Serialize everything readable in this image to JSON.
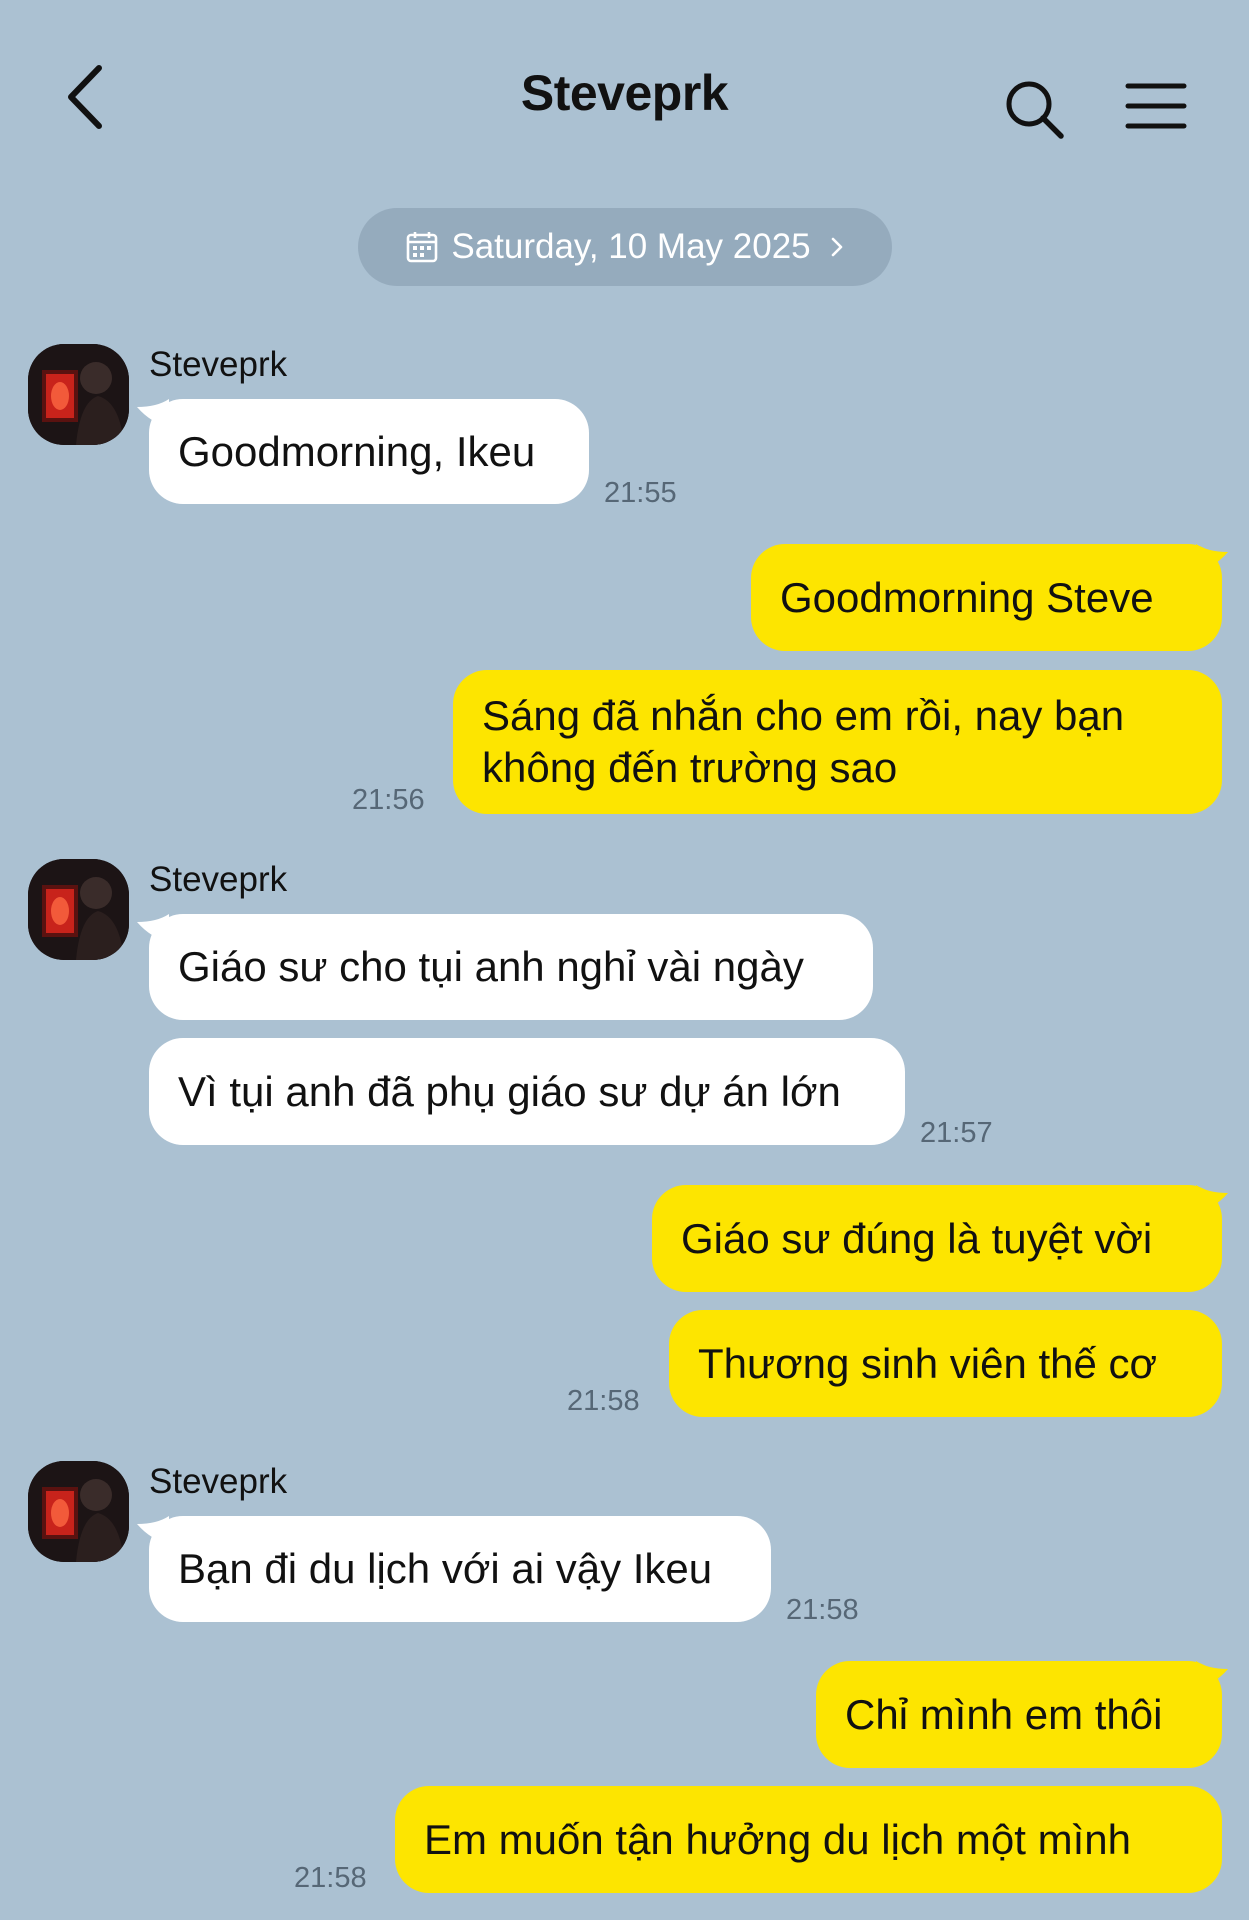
{
  "header": {
    "title": "Steveprk"
  },
  "date_label": "Saturday, 10 May 2025",
  "incoming": [
    {
      "sender": "Steveprk",
      "messages": [
        "Goodmorning, Ikeu"
      ],
      "time": "21:55"
    },
    {
      "sender": "Steveprk",
      "messages": [
        "Giáo sư cho tụi anh nghỉ vài ngày",
        "Vì tụi anh đã phụ giáo sư dự án lớn"
      ],
      "time": "21:57"
    },
    {
      "sender": "Steveprk",
      "messages": [
        "Bạn đi du lịch với ai vậy Ikeu"
      ],
      "time": "21:58"
    }
  ],
  "outgoing": [
    {
      "messages": [
        "Goodmorning Steve",
        [
          "Sáng đã nhắn cho em rồi, nay bạn",
          "không đến trường sao"
        ]
      ],
      "time": "21:56"
    },
    {
      "messages": [
        "Giáo sư đúng là tuyệt vời",
        "Thương sinh viên thế cơ"
      ],
      "time": "21:58"
    },
    {
      "messages": [
        "Chỉ mình em thôi",
        "Em muốn tận hưởng du lịch một mình"
      ],
      "time": "21:58"
    }
  ],
  "icons": {
    "back": "chevron-left-icon",
    "search": "search-icon",
    "menu": "hamburger-menu-icon",
    "calendar": "calendar-icon",
    "date_chevron": "chevron-right-icon"
  },
  "colors": {
    "background": "#abc1d2",
    "incoming_bubble": "#ffffff",
    "outgoing_bubble": "#fde500",
    "date_pill": "#95abbd",
    "timestamp": "#566776"
  }
}
